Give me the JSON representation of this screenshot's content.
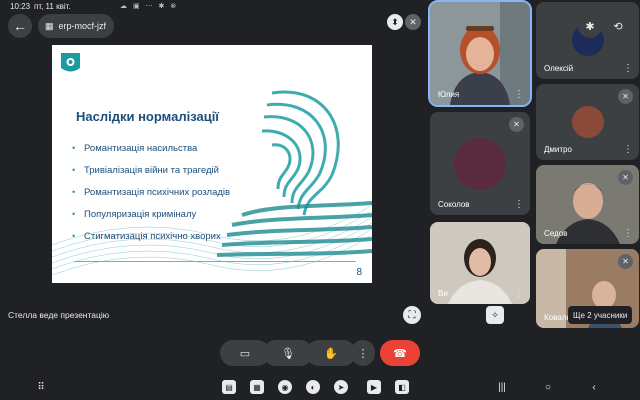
{
  "status": {
    "time": "10:23",
    "date": "пт, 11 квіт.",
    "icons": "☁ ▣ ⋯ ✱ ⊗",
    "right": "✱ ⊘ ▾ ▮"
  },
  "header": {
    "meeting_code": "erp-mocf-jzf"
  },
  "slide": {
    "title": "Наслідки нормалізації",
    "bullets": [
      "Романтизація насильства",
      "Тривіалізація війни та трагедій",
      "Романтизація психічних розладів",
      "Популяризація криміналу",
      "Стигматизація психічно хворих"
    ],
    "number": "8"
  },
  "presenter_caption": "Стелла веде презентацію",
  "participants": {
    "yulia": "Юлия",
    "oleksii": "Олексій",
    "dmytro": "Дмитро",
    "sokolov": "Соколов",
    "sedov": "Седов",
    "vy": "Ви",
    "koval": "Коваль"
  },
  "more_participants": "Ще 2 учасники",
  "colors": {
    "end_call": "#ea4335",
    "slide_title": "#1e4e79",
    "accent_teal": "#2aa3a8"
  }
}
